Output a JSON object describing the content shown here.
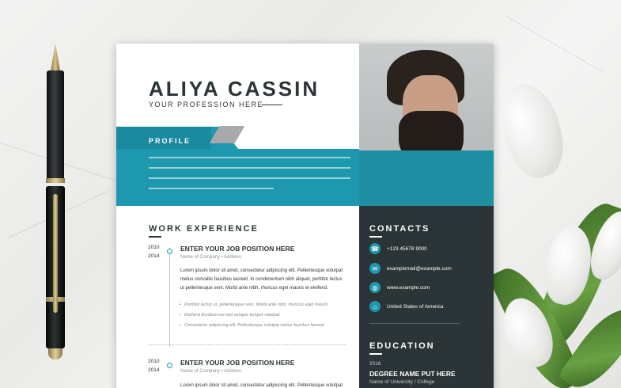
{
  "resume": {
    "name": "ALIYA CASSIN",
    "profession": "YOUR PROFESSION HERE",
    "profile_heading": "PROFILE",
    "work_heading": "WORK EXPERIENCE",
    "jobs": [
      {
        "year_start": "2010",
        "year_end": "2014",
        "title": "ENTER YOUR JOB POSITION HERE",
        "company": "Name of Company • Address",
        "description": [
          "Lorem ipsum dolor sit amet, consectetur adipiscing elit. Pellentesque volutpat",
          "metus convallis faucibus laoreet. In condimentum nibh aliquet, porttitor lectus",
          "ut pellentesque sem. Morbi ante nibh, rhoncus eget mauris et eleifend."
        ],
        "bullets": [
          "Porttitor lectus ut, pellentesque sem. Morbi ante nibh, rhoncus eget mauris",
          "Eleifend tincidunt est sed semper tempor volutpat",
          "Consectetur adipiscing elit. Pellentesque volutpat metus faucibus laoreet"
        ]
      },
      {
        "year_start": "2010",
        "year_end": "2014",
        "title": "ENTER YOUR JOB POSITION HERE",
        "company": "Name of Company • Address",
        "description": [
          "Lorem ipsum dolor sit amet, consectetur adipiscing elit. Pellentesque volutpat"
        ]
      }
    ],
    "contacts_heading": "CONTACTS",
    "contacts": [
      {
        "icon": "phone-icon",
        "glyph": "☎",
        "text": "+123 45678 9000"
      },
      {
        "icon": "email-icon",
        "glyph": "✉",
        "text": "examplemail@example.com"
      },
      {
        "icon": "globe-icon",
        "glyph": "◍",
        "text": "www.example.com"
      },
      {
        "icon": "home-icon",
        "glyph": "⌂",
        "text": "United States of America"
      }
    ],
    "education_heading": "EDUCATION",
    "education": {
      "year": "2016",
      "degree": "DEGREE NAME PUT HERE",
      "school": "Name of University / College"
    }
  },
  "colors": {
    "accent_teal": "#1e98ae",
    "dark_panel": "#2b3437"
  }
}
